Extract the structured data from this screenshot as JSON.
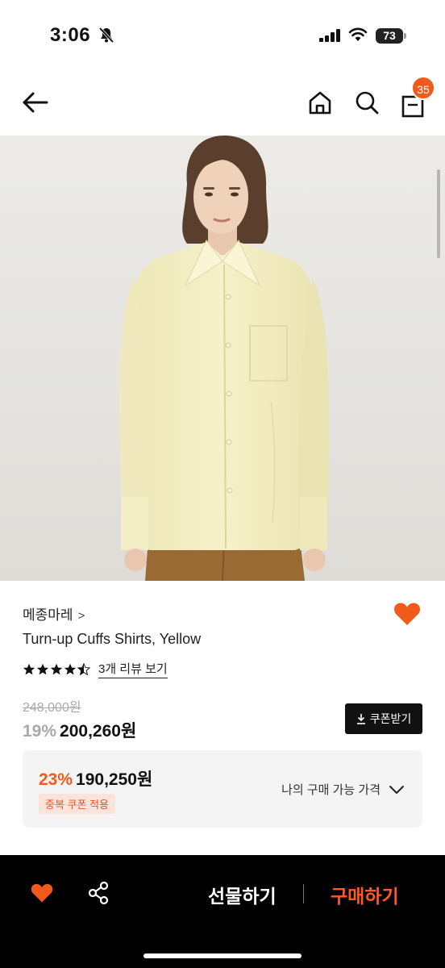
{
  "status": {
    "time": "3:06",
    "battery": "73"
  },
  "nav": {
    "cart_count": "35"
  },
  "product": {
    "brand": "메종마레",
    "brand_chevron": ">",
    "name": "Turn-up Cuffs Shirts, Yellow",
    "rating_stars": 4.5,
    "review_link": "3개 리뷰 보기",
    "original_price": "248,000원",
    "discount_pct": "19%",
    "sale_price": "200,260원",
    "coupon_button": "쿠폰받기"
  },
  "coupon_box": {
    "pct": "23%",
    "price": "190,250원",
    "tag": "중복 쿠폰 적용",
    "my_price_label": "나의 구매 가능 가격"
  },
  "bottom_bar": {
    "gift_label": "선물하기",
    "buy_label": "구매하기"
  },
  "colors": {
    "accent": "#f05a1a",
    "buy": "#ff5a1f",
    "shirt": "#f4efc4",
    "pants": "#9a6a35"
  }
}
